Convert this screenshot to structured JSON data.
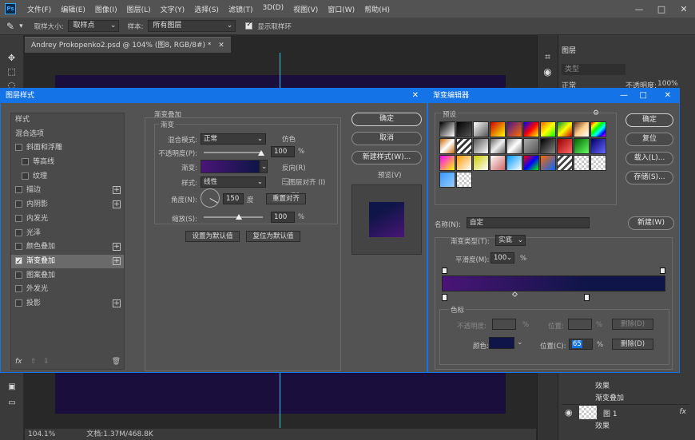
{
  "menubar": {
    "logo": "Ps",
    "items": [
      "文件(F)",
      "编辑(E)",
      "图像(I)",
      "图层(L)",
      "文字(Y)",
      "选择(S)",
      "滤镜(T)",
      "3D(D)",
      "视图(V)",
      "窗口(W)",
      "帮助(H)"
    ],
    "min": "—",
    "max": "□",
    "close": "✕"
  },
  "options": {
    "sample_size_label": "取样大小:",
    "sample_size_value": "取样点",
    "sample_label": "样本:",
    "sample_value": "所有图层",
    "show_ring_label": "显示取样环"
  },
  "document": {
    "tab": "Andrey Prokopenko2.psd @ 104% (图8, RGB/8#) *",
    "zoom": "104.1%",
    "docinfo": "文档:1.37M/468.8K"
  },
  "right_panel": {
    "layers_tab": "图层",
    "search_placeholder": "类型",
    "blend": "正常",
    "opacity_label": "不透明度:",
    "opacity_value": "100%",
    "effects_label": "效果",
    "gradient_overlay_label": "渐变叠加",
    "layer1_name": "图 1",
    "effects_label_2": "效果",
    "fx": "fx"
  },
  "layer_style": {
    "title": "图层样式",
    "close": "✕",
    "list": [
      {
        "label": "样式",
        "checkbox": false,
        "plus": false,
        "header": true
      },
      {
        "label": "混合选项",
        "checkbox": false,
        "plus": false,
        "header": true
      },
      {
        "label": "斜面和浮雕",
        "checkbox": true,
        "checked": false,
        "plus": false
      },
      {
        "label": "等高线",
        "checkbox": true,
        "checked": false,
        "plus": false,
        "indent": true
      },
      {
        "label": "纹理",
        "checkbox": true,
        "checked": false,
        "plus": false,
        "indent": true
      },
      {
        "label": "描边",
        "checkbox": true,
        "checked": false,
        "plus": true
      },
      {
        "label": "内阴影",
        "checkbox": true,
        "checked": false,
        "plus": true
      },
      {
        "label": "内发光",
        "checkbox": true,
        "checked": false,
        "plus": false
      },
      {
        "label": "光泽",
        "checkbox": true,
        "checked": false,
        "plus": false
      },
      {
        "label": "颜色叠加",
        "checkbox": true,
        "checked": false,
        "plus": true
      },
      {
        "label": "渐变叠加",
        "checkbox": true,
        "checked": true,
        "plus": true,
        "selected": true
      },
      {
        "label": "图案叠加",
        "checkbox": true,
        "checked": false,
        "plus": false
      },
      {
        "label": "外发光",
        "checkbox": true,
        "checked": false,
        "plus": false
      },
      {
        "label": "投影",
        "checkbox": true,
        "checked": false,
        "plus": true
      }
    ],
    "footer_fx": "fx",
    "section_title": "渐变叠加",
    "group_title": "渐变",
    "blend_label": "混合模式:",
    "blend_value": "正常",
    "dither_label": "仿色",
    "opacity_label": "不透明度(P):",
    "opacity_value": "100",
    "percent": "%",
    "gradient_label": "渐变:",
    "reverse_label": "反向(R)",
    "style_label": "样式:",
    "style_value": "线性",
    "align_label": "与图层对齐 (I)",
    "angle_label": "角度(N):",
    "angle_value": "150",
    "degree": "度",
    "reset_align": "重置对齐",
    "scale_label": "缩放(S):",
    "scale_value": "100",
    "set_default": "设置为默认值",
    "reset_default": "复位为默认值",
    "ok": "确定",
    "cancel": "取消",
    "new_style": "新建样式(W)...",
    "preview_label": "预览(V)"
  },
  "gradient_editor": {
    "title": "渐变编辑器",
    "presets_label": "预设",
    "gear": "⚙",
    "ok": "确定",
    "reset": "复位",
    "load": "载入(L)...",
    "save": "存储(S)...",
    "name_label": "名称(N):",
    "name_value": "自定",
    "new_button": "新建(W)",
    "type_label": "渐变类型(T):",
    "type_value": "实底",
    "smooth_label": "平滑度(M):",
    "smooth_value": "100",
    "percent": "%",
    "stops_title": "色标",
    "stop_opacity_label": "不透明度:",
    "position_label": "位置:",
    "delete_label": "删除(D)",
    "color_label": "颜色:",
    "color_position_label": "位置(C):",
    "color_position_value": "65",
    "gradient_start": "#4a1577",
    "gradient_end": "#0f1548",
    "min": "—",
    "max": "□",
    "close": "✕"
  }
}
